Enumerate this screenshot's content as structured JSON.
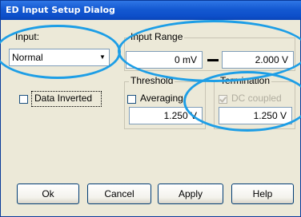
{
  "window": {
    "title": "ED Input Setup Dialog"
  },
  "input": {
    "label": "Input:",
    "selected": "Normal"
  },
  "input_range": {
    "title": "Input Range",
    "min_value": "0 mV",
    "max_value": "2.000 V"
  },
  "data_inverted": {
    "label": "Data Inverted",
    "checked": false
  },
  "threshold": {
    "title": "Threshold",
    "averaging_label": "Averaging",
    "averaging_checked": false,
    "value": "1.250 V"
  },
  "termination": {
    "title": "Termination",
    "dc_coupled_label": "DC coupled",
    "dc_coupled_checked": true,
    "value": "1.250 V"
  },
  "buttons": {
    "ok": "Ok",
    "cancel": "Cancel",
    "apply": "Apply",
    "help": "Help"
  },
  "colors": {
    "highlight_ellipse": "#1d9ee6",
    "titlebar": "#1459d1"
  }
}
